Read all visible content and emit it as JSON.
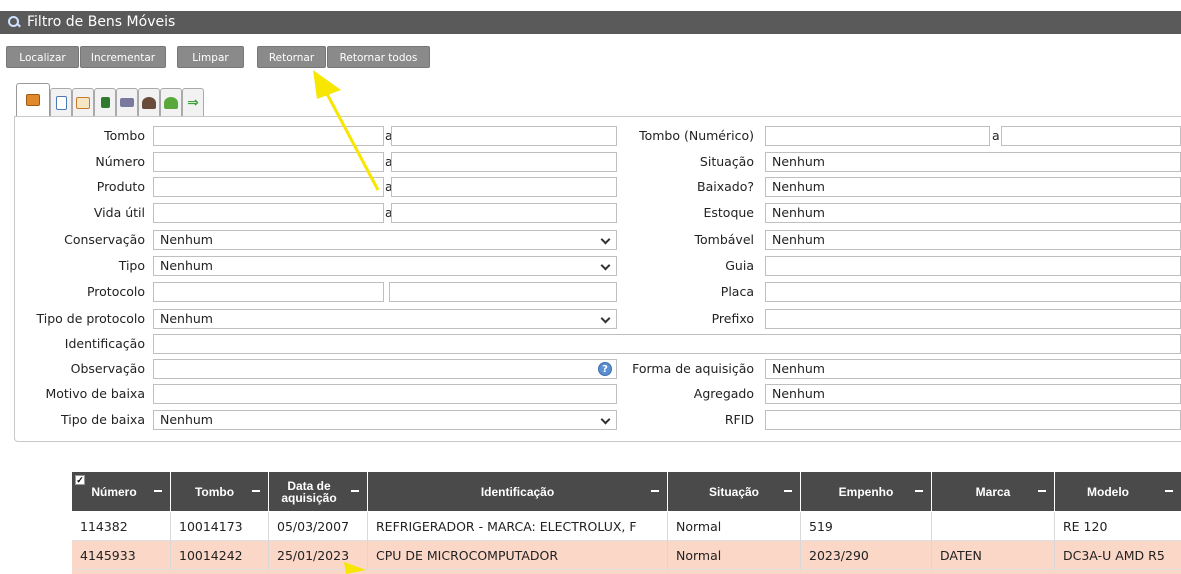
{
  "window": {
    "title": "Filtro de Bens Móveis"
  },
  "toolbar": {
    "localizar": "Localizar",
    "incrementar": "Incrementar",
    "limpar": "Limpar",
    "retornar": "Retornar",
    "retornar_todos": "Retornar todos"
  },
  "tabs": [
    "general-tab-icon",
    "document-tab-icon",
    "calendar-tab-icon",
    "flag-tab-icon",
    "truck-tab-icon",
    "person-tab-icon",
    "user-green-tab-icon",
    "arrow-right-tab-icon"
  ],
  "form": {
    "tombo": "Tombo",
    "numero": "Número",
    "produto": "Produto",
    "vida_util": "Vida útil",
    "conservacao": "Conservação",
    "tipo": "Tipo",
    "protocolo": "Protocolo",
    "tipo_protocolo": "Tipo de protocolo",
    "identificacao": "Identificação",
    "observacao": "Observação",
    "motivo_baixa": "Motivo de baixa",
    "tipo_baixa": "Tipo de baixa",
    "range_sep": "a",
    "none": "Nenhum",
    "tombo_numerico": "Tombo (Numérico)",
    "situacao": "Situação",
    "baixado": "Baixado?",
    "estoque": "Estoque",
    "tombavel": "Tombável",
    "guia": "Guia",
    "placa": "Placa",
    "prefixo": "Prefixo",
    "forma_aquisicao": "Forma de aquisição",
    "agregado": "Agregado",
    "rfid": "RFID"
  },
  "grid": {
    "headers": {
      "numero": "Número",
      "tombo": "Tombo",
      "data_l1": "Data de",
      "data_l2": "aquisição",
      "identificacao": "Identificação",
      "situacao": "Situação",
      "empenho": "Empenho",
      "marca": "Marca",
      "modelo": "Modelo"
    },
    "rows": [
      {
        "numero": "114382",
        "tombo": "10014173",
        "data": "05/03/2007",
        "identificacao": "REFRIGERADOR - MARCA: ELECTROLUX, F",
        "situacao": "Normal",
        "empenho": "519",
        "marca": "",
        "modelo": "RE 120"
      },
      {
        "numero": "4145933",
        "tombo": "10014242",
        "data": "25/01/2023",
        "identificacao": "CPU DE MICROCOMPUTADOR",
        "situacao": "Normal",
        "empenho": "2023/290",
        "marca": "DATEN",
        "modelo": "DC3A-U AMD R5"
      }
    ]
  },
  "colors": {
    "titlebar": "#5a5a5a",
    "button": "#8a8a8a",
    "header": "#4a4a4a",
    "selected_row": "#fbd7c8",
    "annotation_arrow": "#f7e600"
  }
}
